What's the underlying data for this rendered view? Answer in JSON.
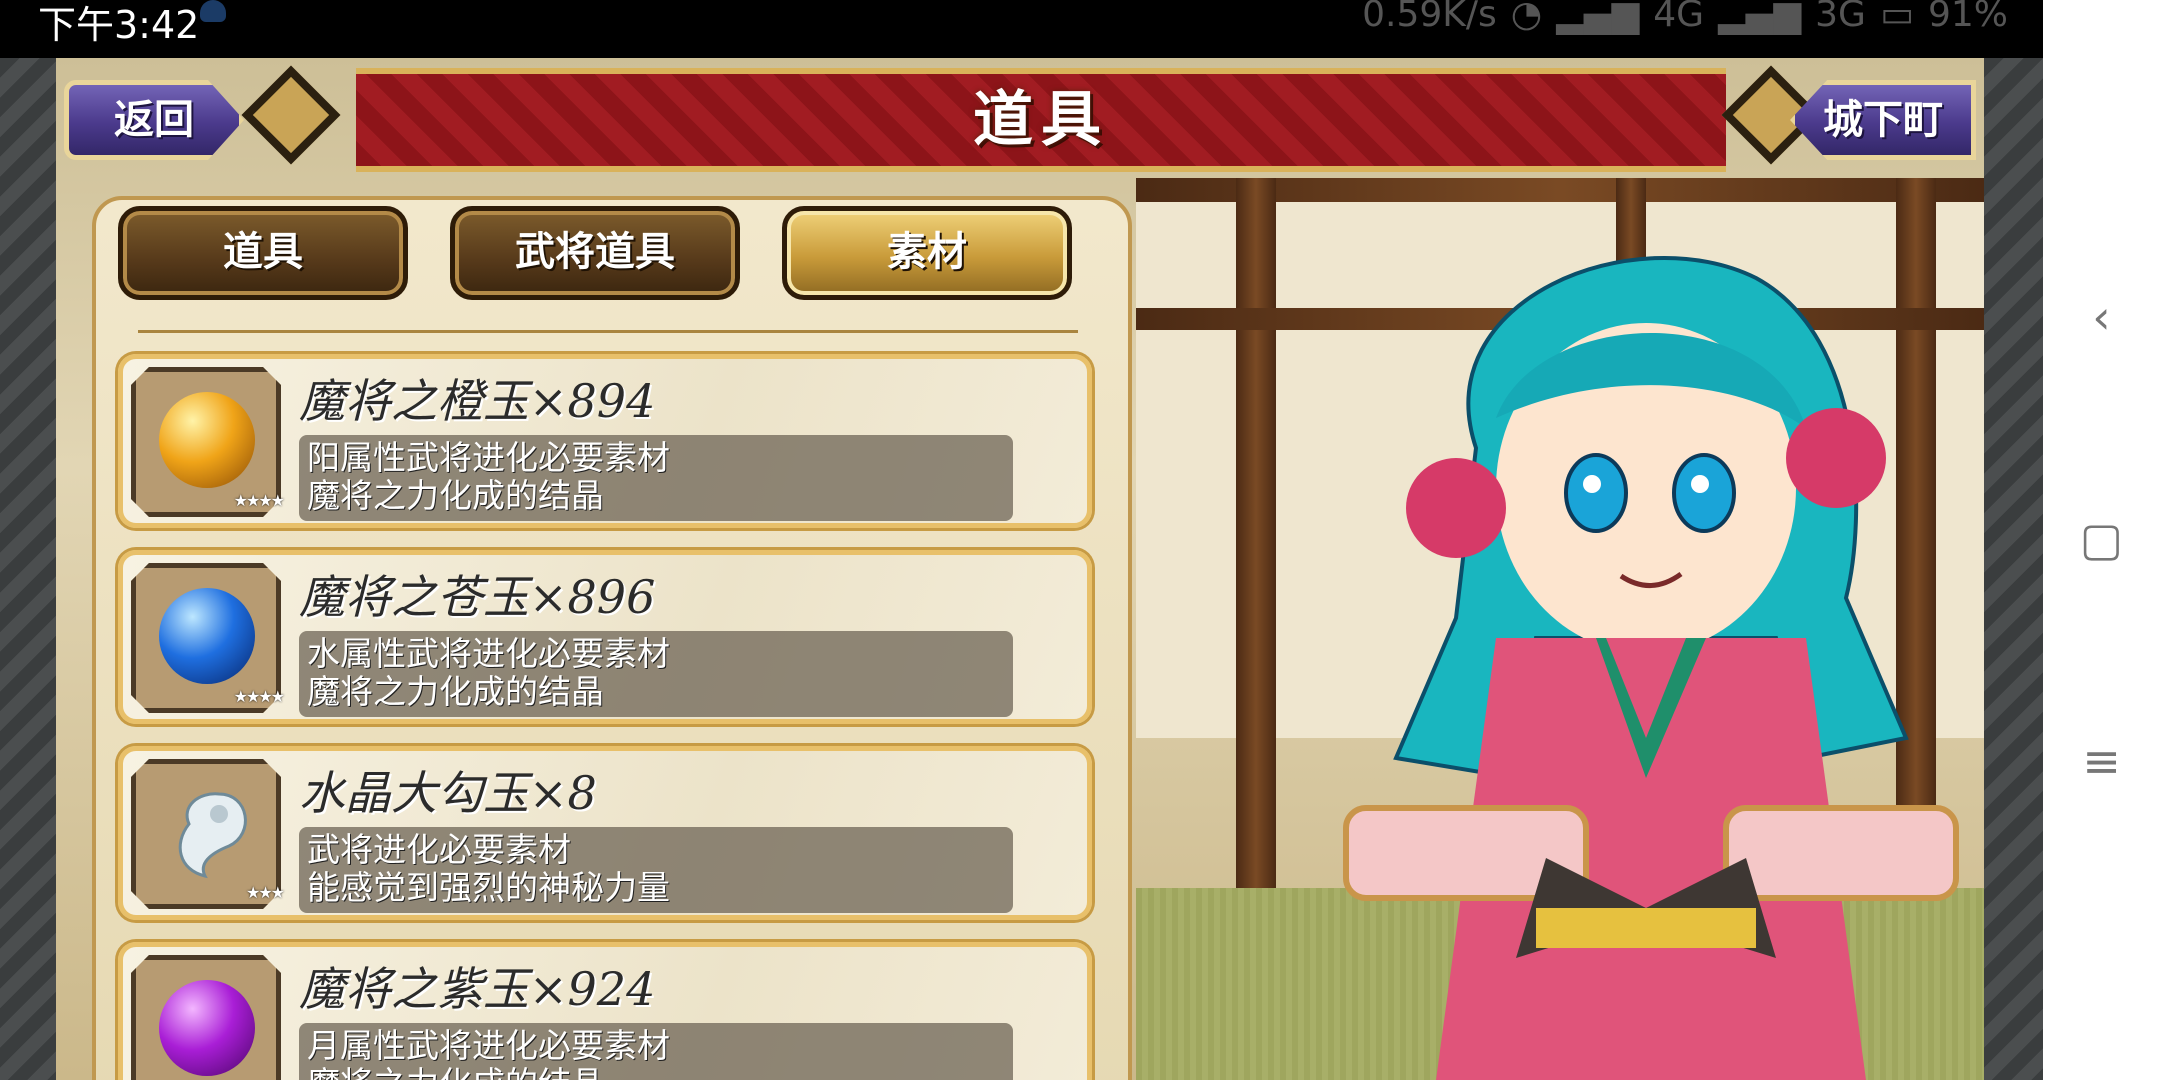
{
  "status_bar": {
    "time": "下午3:42",
    "network_speed": "0.59K/s",
    "signal1": "4G",
    "signal2": "3G",
    "battery": "91%"
  },
  "header": {
    "title": "道具",
    "back_label": "返回",
    "town_label": "城下町"
  },
  "tabs": [
    {
      "label": "道具",
      "active": false
    },
    {
      "label": "武将道具",
      "active": false
    },
    {
      "label": "素材",
      "active": true
    }
  ],
  "items": [
    {
      "name": "魔将之橙玉×894",
      "desc1": "阳属性武将进化必要素材",
      "desc2": "魔将之力化成的结晶",
      "stars": "★★★★",
      "orb_color": "#f0a418"
    },
    {
      "name": "魔将之苍玉×896",
      "desc1": "水属性武将进化必要素材",
      "desc2": "魔将之力化成的结晶",
      "stars": "★★★★",
      "orb_color": "#1f6fe0"
    },
    {
      "name": "水晶大勾玉×8",
      "desc1": "武将进化必要素材",
      "desc2": "能感觉到强烈的神秘力量",
      "stars": "★★★",
      "orb_color": "#dfe6ea"
    },
    {
      "name": "魔将之紫玉×924",
      "desc1": "月属性武将进化必要素材",
      "desc2": "魔将之力化成的结晶",
      "stars": "★★★★",
      "orb_color": "#a91ed6"
    }
  ],
  "android_nav": {
    "back_icon": "‹",
    "home_icon": "▢",
    "menu_icon": "≡"
  }
}
